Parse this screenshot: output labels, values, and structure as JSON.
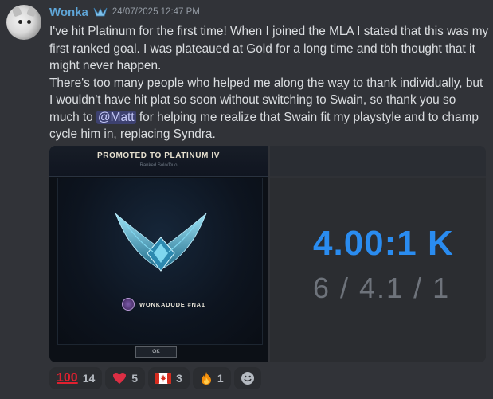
{
  "message": {
    "username": "Wonka",
    "username_color": "#5fa6d8",
    "timestamp": "24/07/2025 12:47 PM",
    "paragraph1": "I've hit Platinum for the first time! When I joined the MLA I stated that this was my first ranked goal. I was plateaued at Gold for a long time and tbh thought that it might never happen.",
    "paragraph2_before": "There's too many people who helped me along the way to thank individually, but I wouldn't have hit plat so soon without switching to Swain, so thank you so much to ",
    "mention": "@Matt",
    "paragraph2_after": " for helping me realize that Swain fit my playstyle and to champ cycle him in, replacing Syndra."
  },
  "attachments": {
    "left": {
      "title": "PROMOTED TO PLATINUM IV",
      "subtitle": "Ranked Solo/Duo",
      "summoner": "WONKADUDE #NA1",
      "ok_label": "OK",
      "emblem_icon": "platinum-emblem-icon"
    },
    "right": {
      "kda_ratio": "4.00:1 K",
      "kda_avg": "6 / 4.1 / 1",
      "ratio_color": "#2a8cf0"
    }
  },
  "reactions": [
    {
      "emoji": "hundred-points-icon",
      "glyph": "100",
      "count": "14"
    },
    {
      "emoji": "red-heart-icon",
      "count": "5"
    },
    {
      "emoji": "canada-flag-icon",
      "count": "3"
    },
    {
      "emoji": "fire-icon",
      "count": "1"
    }
  ],
  "add_reaction_icon": "add-reaction-icon",
  "colors": {
    "background": "#313338",
    "text": "#dbdee1",
    "timestamp": "#949ba4",
    "mention_bg": "#3c4270",
    "reaction_bg": "#2b2d31"
  }
}
